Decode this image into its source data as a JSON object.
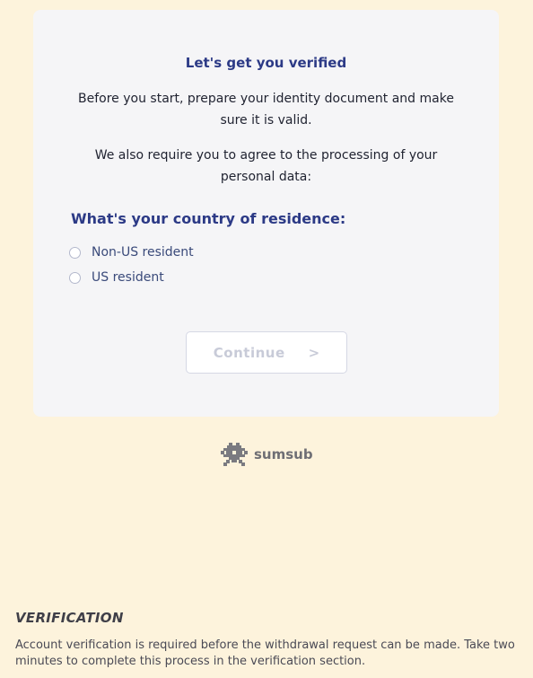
{
  "card": {
    "title": "Let's get you verified",
    "paragraph1": "Before you start, prepare your identity document and make sure it is valid.",
    "paragraph2": "We also require you to agree to the processing of your personal data:",
    "question": "What's your country of residence:",
    "options": [
      {
        "label": "Non-US resident",
        "selected": false
      },
      {
        "label": "US resident",
        "selected": false
      }
    ],
    "continue_label": "Continue",
    "continue_arrow": ">"
  },
  "brand": {
    "name": "sumsub",
    "icon": "sumsub-logo-icon"
  },
  "verification": {
    "heading": "VERIFICATION",
    "text": "Account verification is required before the withdrawal request can be made. Take two minutes to complete this process in the verification section."
  },
  "colors": {
    "background": "#fdf3dc",
    "card": "#f5f5f7",
    "accent": "#2c3a86",
    "disabled": "#c8cbd8"
  }
}
